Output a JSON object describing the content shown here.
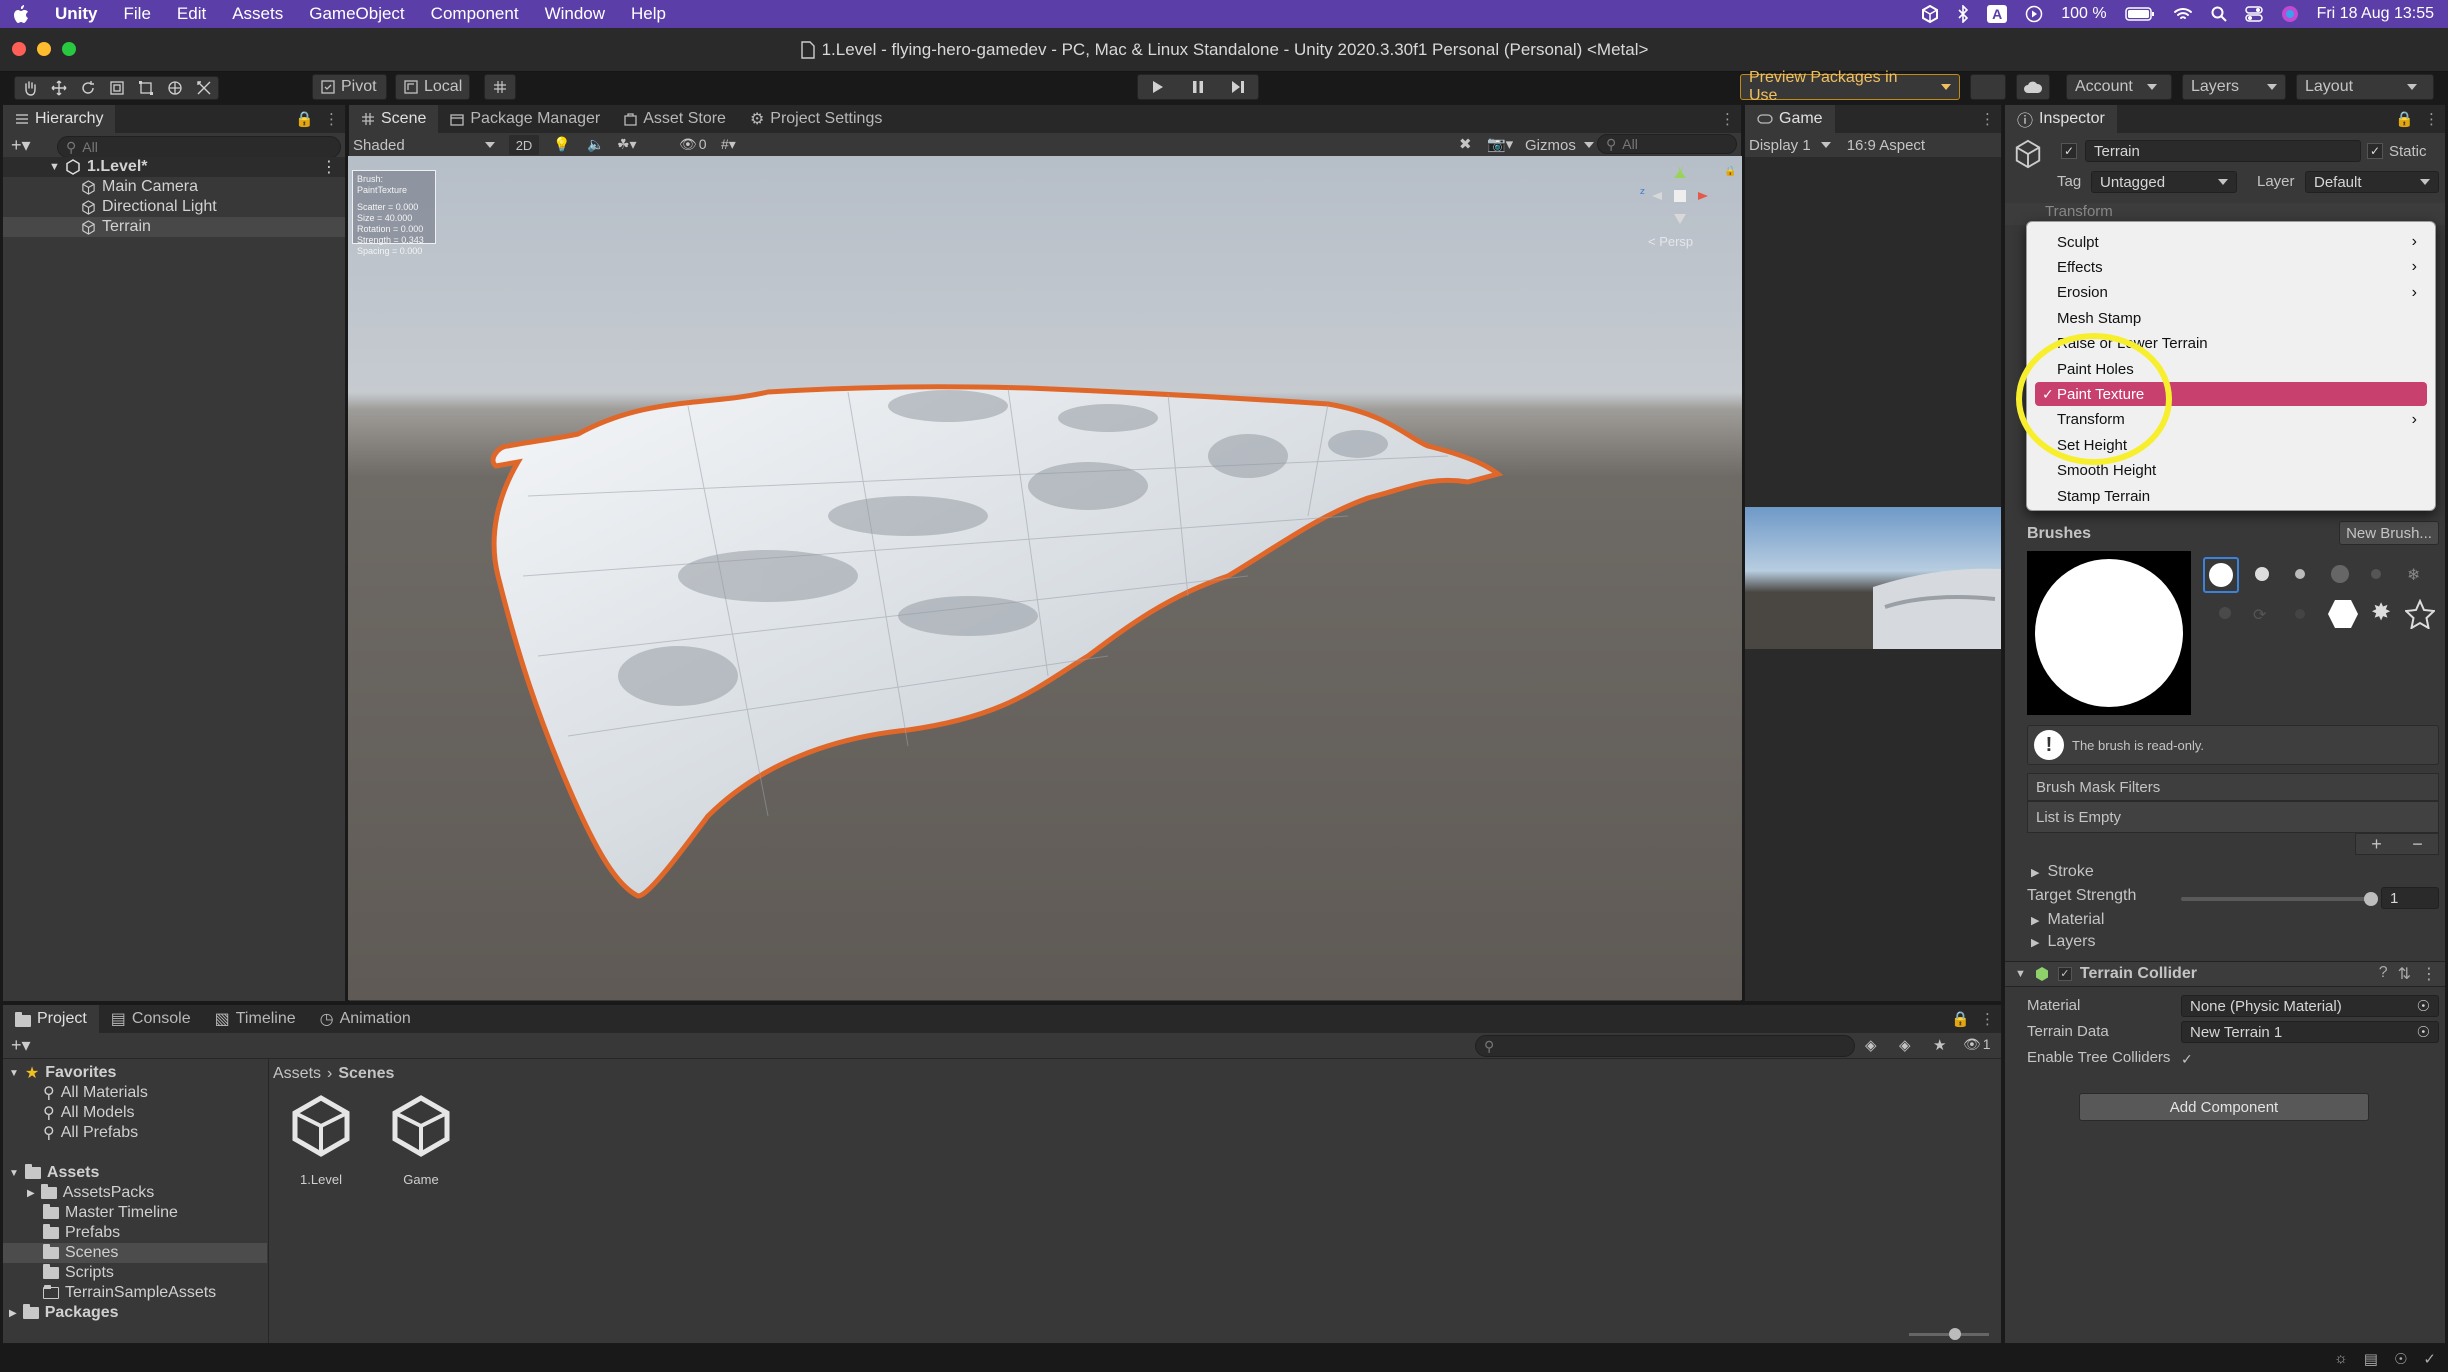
{
  "menubar": {
    "apple": "",
    "app": "Unity",
    "items": [
      "File",
      "Edit",
      "Assets",
      "GameObject",
      "Component",
      "Window",
      "Help"
    ],
    "battery": "100 %",
    "datetime": "Fri 18 Aug  13:55",
    "input_source": "A"
  },
  "window": {
    "title": "1.Level - flying-hero-gamedev - PC, Mac & Linux Standalone - Unity 2020.3.30f1 Personal (Personal) <Metal>"
  },
  "toolbar": {
    "pivot": "Pivot",
    "local": "Local",
    "preview_packages": "Preview Packages in Use",
    "account": "Account",
    "layers": "Layers",
    "layout": "Layout"
  },
  "hierarchy": {
    "tab": "Hierarchy",
    "search_placeholder": "All",
    "scene": "1.Level*",
    "objects": [
      "Main Camera",
      "Directional Light",
      "Terrain"
    ],
    "selected": "Terrain"
  },
  "scene": {
    "tabs": [
      "Scene",
      "Package Manager",
      "Asset Store",
      "Project Settings"
    ],
    "shading": "Shaded",
    "mode_2d": "2D",
    "hidden_count": "0",
    "gizmos": "Gizmos",
    "search_placeholder": "All",
    "persp": "< Persp",
    "brush_info": {
      "title": "Brush: PaintTexture",
      "lines": [
        "Scatter = 0.000",
        "Size = 40.000",
        "Rotation = 0.000",
        "Strength = 0.343",
        "Spacing = 0.000"
      ]
    }
  },
  "game": {
    "tab": "Game",
    "display": "Display 1",
    "aspect": "16:9 Aspect"
  },
  "inspector": {
    "tab": "Inspector",
    "object_name": "Terrain",
    "static": "Static",
    "tag_label": "Tag",
    "tag_value": "Untagged",
    "layer_label": "Layer",
    "layer_value": "Default",
    "transform_partial": "Transform",
    "tool_menu": [
      {
        "label": "Sculpt",
        "submenu": true,
        "checked": false
      },
      {
        "label": "Effects",
        "submenu": true,
        "checked": false
      },
      {
        "label": "Erosion",
        "submenu": true,
        "checked": false
      },
      {
        "label": "Mesh Stamp",
        "submenu": false,
        "checked": false
      },
      {
        "label": "Raise or Lower Terrain",
        "submenu": false,
        "checked": false
      },
      {
        "label": "Paint Holes",
        "submenu": false,
        "checked": false
      },
      {
        "label": "Paint Texture",
        "submenu": false,
        "checked": true
      },
      {
        "label": "Transform",
        "submenu": true,
        "checked": false
      },
      {
        "label": "Set Height",
        "submenu": false,
        "checked": false
      },
      {
        "label": "Smooth Height",
        "submenu": false,
        "checked": false
      },
      {
        "label": "Stamp Terrain",
        "submenu": false,
        "checked": false
      }
    ],
    "brushes_label": "Brushes",
    "new_brush": "New Brush...",
    "readonly_note": "The brush is read-only.",
    "mask_filters": "Brush Mask Filters",
    "list_empty": "List is Empty",
    "stroke": "Stroke",
    "target_strength_label": "Target Strength",
    "target_strength_value": "1",
    "target_strength_level": 1.0,
    "material_section": "Material",
    "layers_section": "Layers",
    "collider": {
      "title": "Terrain Collider",
      "material_label": "Material",
      "material_value": "None (Physic Material)",
      "data_label": "Terrain Data",
      "data_value": "New Terrain 1",
      "tree_label": "Enable Tree Colliders"
    },
    "add_component": "Add Component"
  },
  "project": {
    "tabs": [
      "Project",
      "Console",
      "Timeline",
      "Animation"
    ],
    "favorites": "Favorites",
    "favorite_items": [
      "All Materials",
      "All Models",
      "All Prefabs"
    ],
    "assets": "Assets",
    "asset_folders": [
      "AssetsPacks",
      "Master Timeline",
      "Prefabs",
      "Scenes",
      "Scripts",
      "TerrainSampleAssets"
    ],
    "packages": "Packages",
    "breadcrumb": [
      "Assets",
      "Scenes"
    ],
    "files": [
      "1.Level",
      "Game"
    ],
    "hidden_count": "1"
  }
}
